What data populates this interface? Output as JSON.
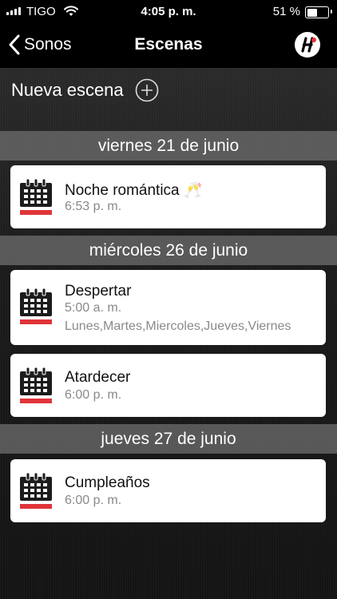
{
  "status_bar": {
    "carrier": "TIGO",
    "time": "4:05 p. m.",
    "battery": "51 %",
    "battery_level": 0.51
  },
  "nav": {
    "back_label": "Sonos",
    "title": "Escenas"
  },
  "new_scene": {
    "label": "Nueva escena"
  },
  "sections": [
    {
      "date": "viernes 21 de junio",
      "scenes": [
        {
          "title": "Noche romántica 🥂",
          "time": "6:53 p. m.",
          "days": ""
        }
      ]
    },
    {
      "date": "miércoles 26 de junio",
      "scenes": [
        {
          "title": "Despertar",
          "time": "5:00 a. m.",
          "days": "Lunes,Martes,Miercoles,Jueves,Viernes"
        },
        {
          "title": "Atardecer",
          "time": "6:00 p. m.",
          "days": ""
        }
      ]
    },
    {
      "date": "jueves 27 de junio",
      "scenes": [
        {
          "title": "Cumpleaños",
          "time": "6:00 p. m.",
          "days": ""
        }
      ]
    }
  ],
  "colors": {
    "calendar_accent": "#e0343a",
    "header_bg": "#6e6e6e"
  }
}
